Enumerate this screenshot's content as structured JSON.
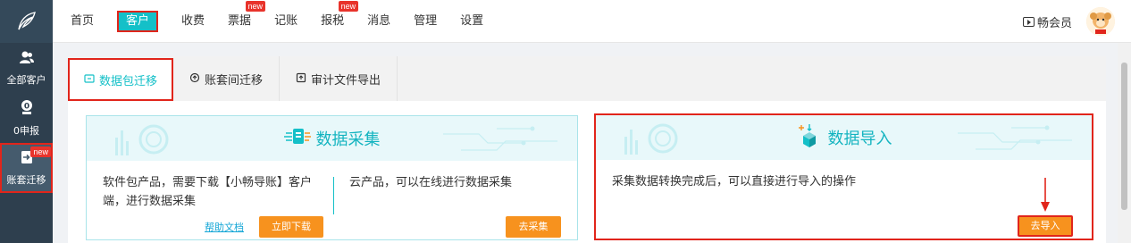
{
  "sidebar": {
    "items": [
      {
        "label": "全部客户",
        "icon": "users-icon"
      },
      {
        "label": "0申报",
        "icon": "zero-declare-icon"
      },
      {
        "label": "账套迁移",
        "icon": "migrate-icon",
        "badge": "new"
      }
    ]
  },
  "nav": {
    "items": [
      {
        "label": "首页"
      },
      {
        "label": "客户"
      },
      {
        "label": "收费"
      },
      {
        "label": "票据",
        "badge": "new"
      },
      {
        "label": "记账"
      },
      {
        "label": "报税",
        "badge": "new"
      },
      {
        "label": "消息"
      },
      {
        "label": "管理"
      },
      {
        "label": "设置"
      }
    ],
    "vip_label": "畅会员"
  },
  "tabs": [
    {
      "label": "数据包迁移"
    },
    {
      "label": "账套间迁移"
    },
    {
      "label": "审计文件导出"
    }
  ],
  "collect_card": {
    "title": "数据采集",
    "software_text": "软件包产品，需要下载【小畅导账】客户端，进行数据采集",
    "help_link": "帮助文档",
    "download_button": "立即下载",
    "cloud_text": "云产品，可以在线进行数据采集",
    "collect_button": "去采集"
  },
  "import_card": {
    "title": "数据导入",
    "text": "采集数据转换完成后，可以直接进行导入的操作",
    "import_button": "去导入"
  },
  "colors": {
    "accent": "#14c0c8",
    "highlight_border": "#e1251b",
    "button": "#f7921e",
    "sidebar": "#2e3f4e"
  }
}
